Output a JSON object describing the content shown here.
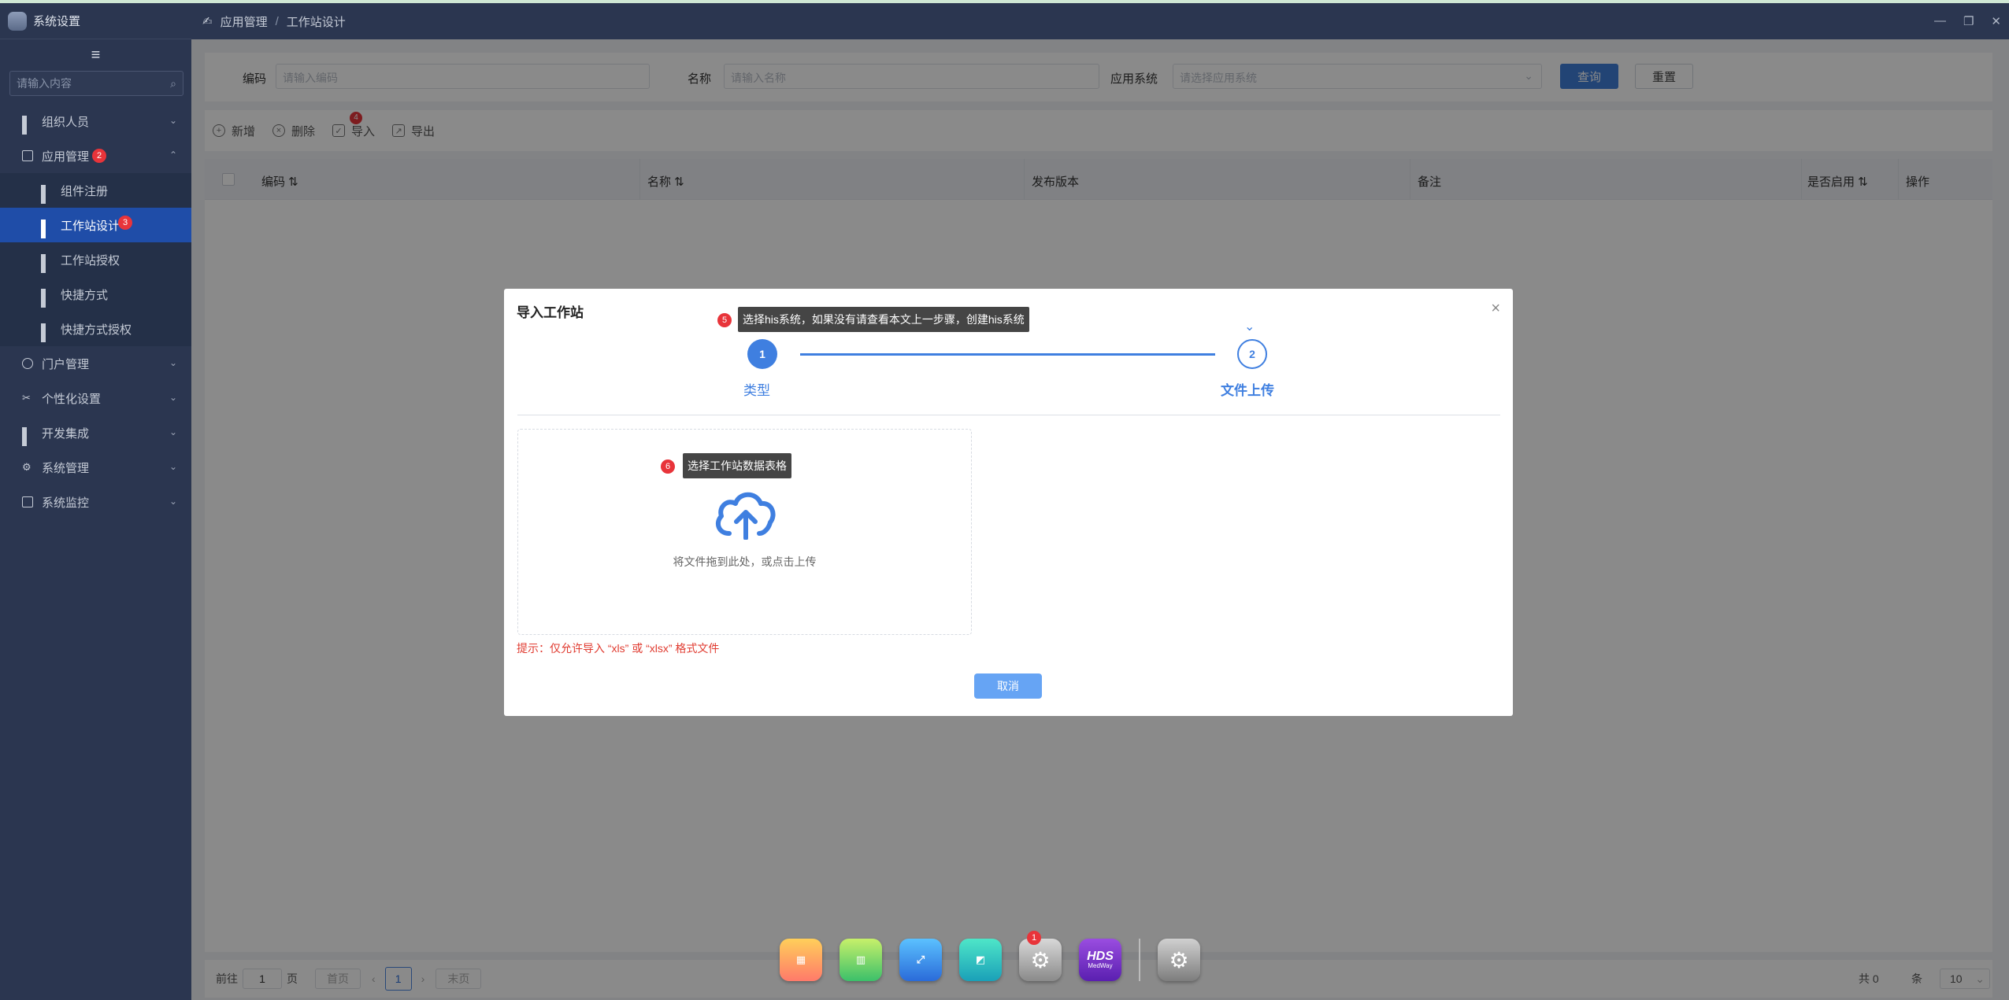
{
  "window": {
    "title": "系统设置"
  },
  "sidebar": {
    "search_placeholder": "请输入内容",
    "items": [
      {
        "label": "组织人员"
      },
      {
        "label": "应用管理",
        "badge": "2"
      },
      {
        "label": "组件注册"
      },
      {
        "label": "工作站设计",
        "badge": "3"
      },
      {
        "label": "工作站授权"
      },
      {
        "label": "快捷方式"
      },
      {
        "label": "快捷方式授权"
      },
      {
        "label": "门户管理"
      },
      {
        "label": "个性化设置"
      },
      {
        "label": "开发集成"
      },
      {
        "label": "系统管理"
      },
      {
        "label": "系统监控"
      }
    ]
  },
  "breadcrumb": {
    "parent": "应用管理",
    "sep": "/",
    "current": "工作站设计"
  },
  "filter": {
    "code_label": "编码",
    "code_placeholder": "请输入编码",
    "name_label": "名称",
    "name_placeholder": "请输入名称",
    "system_label": "应用系统",
    "system_placeholder": "请选择应用系统",
    "query_btn": "查询",
    "reset_btn": "重置"
  },
  "toolbar": {
    "add": "新增",
    "delete": "删除",
    "import": "导入",
    "import_badge": "4",
    "export": "导出"
  },
  "table": {
    "columns": [
      "编码",
      "名称",
      "发布版本",
      "备注",
      "是否启用",
      "操作"
    ]
  },
  "pager": {
    "goto_label": "前往",
    "goto_value": "1",
    "page_unit": "页",
    "first": "首页",
    "current": "1",
    "last": "末页",
    "total": "共 0",
    "per_unit": "条",
    "page_size": "10"
  },
  "modal": {
    "title": "导入工作站",
    "step1_num": "1",
    "step1_label": "类型",
    "step2_num": "2",
    "step2_label": "文件上传",
    "upload_text": "将文件拖到此处，或点击上传",
    "hint": "提示：仅允许导入 “xls” 或 “xlsx” 格式文件",
    "cancel": "取消"
  },
  "annotations": {
    "tip5_badge": "5",
    "tip5": "选择his系统，如果没有请查看本文上一步骤，创建his系统",
    "tip6_badge": "6",
    "tip6": "选择工作站数据表格"
  },
  "dock": {
    "badge": "1",
    "hds_label": "HDS",
    "hds_sub": "MedWay"
  },
  "colors": {
    "primary": "#3f7fe0",
    "sidebar_bg": "#2b3650",
    "active_item": "#1f4da8",
    "danger": "#e8343a"
  }
}
